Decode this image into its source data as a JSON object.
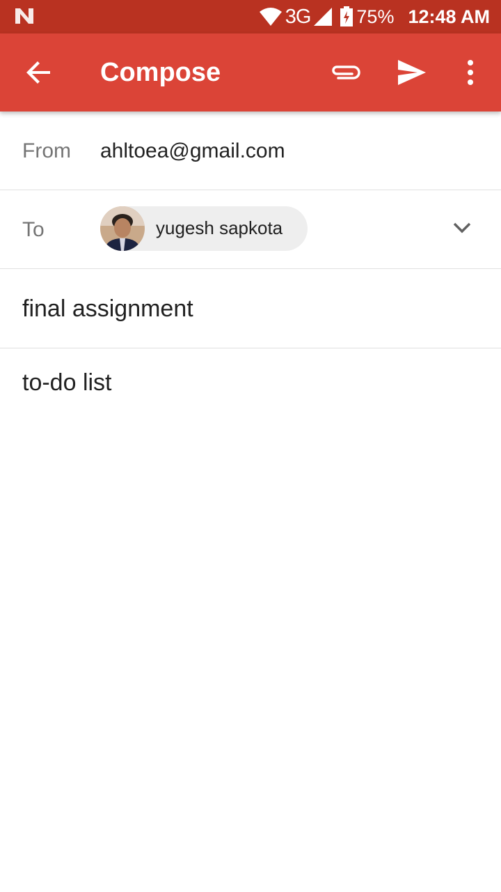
{
  "status_bar": {
    "left_icon": "notification-n-icon",
    "network": "3G",
    "battery_percent": "75%",
    "time": "12:48 AM",
    "wifi_icon": "wifi-icon",
    "signal_icon": "signal-icon",
    "battery_icon": "battery-charging-icon"
  },
  "app_bar": {
    "title": "Compose",
    "back_icon": "arrow-back-icon",
    "attach_icon": "paperclip-icon",
    "send_icon": "send-icon",
    "more_icon": "more-vert-icon"
  },
  "compose": {
    "from_label": "From",
    "from_value": "ahltoea@gmail.com",
    "to_label": "To",
    "to_recipient": "yugesh sapkota",
    "expand_icon": "chevron-down-icon",
    "subject": "final assignment",
    "body": "to-do list"
  },
  "colors": {
    "status_bar": "#b93221",
    "app_bar": "#db4437",
    "chip_bg": "#eeeeee",
    "divider": "#e0e0e0"
  }
}
